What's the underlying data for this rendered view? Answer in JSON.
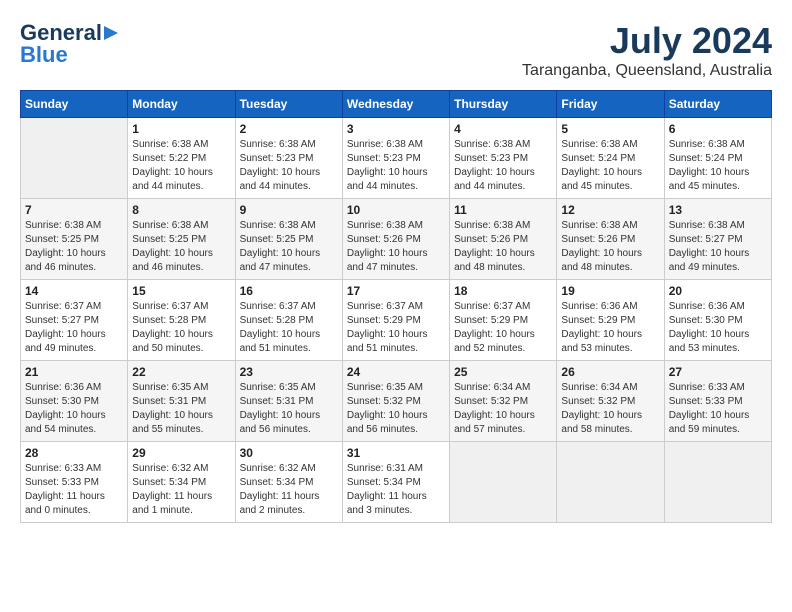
{
  "header": {
    "logo_line1": "General",
    "logo_line2": "Blue",
    "month": "July 2024",
    "location": "Taranganba, Queensland, Australia"
  },
  "weekdays": [
    "Sunday",
    "Monday",
    "Tuesday",
    "Wednesday",
    "Thursday",
    "Friday",
    "Saturday"
  ],
  "weeks": [
    [
      {
        "day": "",
        "info": ""
      },
      {
        "day": "1",
        "info": "Sunrise: 6:38 AM\nSunset: 5:22 PM\nDaylight: 10 hours\nand 44 minutes."
      },
      {
        "day": "2",
        "info": "Sunrise: 6:38 AM\nSunset: 5:23 PM\nDaylight: 10 hours\nand 44 minutes."
      },
      {
        "day": "3",
        "info": "Sunrise: 6:38 AM\nSunset: 5:23 PM\nDaylight: 10 hours\nand 44 minutes."
      },
      {
        "day": "4",
        "info": "Sunrise: 6:38 AM\nSunset: 5:23 PM\nDaylight: 10 hours\nand 44 minutes."
      },
      {
        "day": "5",
        "info": "Sunrise: 6:38 AM\nSunset: 5:24 PM\nDaylight: 10 hours\nand 45 minutes."
      },
      {
        "day": "6",
        "info": "Sunrise: 6:38 AM\nSunset: 5:24 PM\nDaylight: 10 hours\nand 45 minutes."
      }
    ],
    [
      {
        "day": "7",
        "info": "Sunrise: 6:38 AM\nSunset: 5:25 PM\nDaylight: 10 hours\nand 46 minutes."
      },
      {
        "day": "8",
        "info": "Sunrise: 6:38 AM\nSunset: 5:25 PM\nDaylight: 10 hours\nand 46 minutes."
      },
      {
        "day": "9",
        "info": "Sunrise: 6:38 AM\nSunset: 5:25 PM\nDaylight: 10 hours\nand 47 minutes."
      },
      {
        "day": "10",
        "info": "Sunrise: 6:38 AM\nSunset: 5:26 PM\nDaylight: 10 hours\nand 47 minutes."
      },
      {
        "day": "11",
        "info": "Sunrise: 6:38 AM\nSunset: 5:26 PM\nDaylight: 10 hours\nand 48 minutes."
      },
      {
        "day": "12",
        "info": "Sunrise: 6:38 AM\nSunset: 5:26 PM\nDaylight: 10 hours\nand 48 minutes."
      },
      {
        "day": "13",
        "info": "Sunrise: 6:38 AM\nSunset: 5:27 PM\nDaylight: 10 hours\nand 49 minutes."
      }
    ],
    [
      {
        "day": "14",
        "info": "Sunrise: 6:37 AM\nSunset: 5:27 PM\nDaylight: 10 hours\nand 49 minutes."
      },
      {
        "day": "15",
        "info": "Sunrise: 6:37 AM\nSunset: 5:28 PM\nDaylight: 10 hours\nand 50 minutes."
      },
      {
        "day": "16",
        "info": "Sunrise: 6:37 AM\nSunset: 5:28 PM\nDaylight: 10 hours\nand 51 minutes."
      },
      {
        "day": "17",
        "info": "Sunrise: 6:37 AM\nSunset: 5:29 PM\nDaylight: 10 hours\nand 51 minutes."
      },
      {
        "day": "18",
        "info": "Sunrise: 6:37 AM\nSunset: 5:29 PM\nDaylight: 10 hours\nand 52 minutes."
      },
      {
        "day": "19",
        "info": "Sunrise: 6:36 AM\nSunset: 5:29 PM\nDaylight: 10 hours\nand 53 minutes."
      },
      {
        "day": "20",
        "info": "Sunrise: 6:36 AM\nSunset: 5:30 PM\nDaylight: 10 hours\nand 53 minutes."
      }
    ],
    [
      {
        "day": "21",
        "info": "Sunrise: 6:36 AM\nSunset: 5:30 PM\nDaylight: 10 hours\nand 54 minutes."
      },
      {
        "day": "22",
        "info": "Sunrise: 6:35 AM\nSunset: 5:31 PM\nDaylight: 10 hours\nand 55 minutes."
      },
      {
        "day": "23",
        "info": "Sunrise: 6:35 AM\nSunset: 5:31 PM\nDaylight: 10 hours\nand 56 minutes."
      },
      {
        "day": "24",
        "info": "Sunrise: 6:35 AM\nSunset: 5:32 PM\nDaylight: 10 hours\nand 56 minutes."
      },
      {
        "day": "25",
        "info": "Sunrise: 6:34 AM\nSunset: 5:32 PM\nDaylight: 10 hours\nand 57 minutes."
      },
      {
        "day": "26",
        "info": "Sunrise: 6:34 AM\nSunset: 5:32 PM\nDaylight: 10 hours\nand 58 minutes."
      },
      {
        "day": "27",
        "info": "Sunrise: 6:33 AM\nSunset: 5:33 PM\nDaylight: 10 hours\nand 59 minutes."
      }
    ],
    [
      {
        "day": "28",
        "info": "Sunrise: 6:33 AM\nSunset: 5:33 PM\nDaylight: 11 hours\nand 0 minutes."
      },
      {
        "day": "29",
        "info": "Sunrise: 6:32 AM\nSunset: 5:34 PM\nDaylight: 11 hours\nand 1 minute."
      },
      {
        "day": "30",
        "info": "Sunrise: 6:32 AM\nSunset: 5:34 PM\nDaylight: 11 hours\nand 2 minutes."
      },
      {
        "day": "31",
        "info": "Sunrise: 6:31 AM\nSunset: 5:34 PM\nDaylight: 11 hours\nand 3 minutes."
      },
      {
        "day": "",
        "info": ""
      },
      {
        "day": "",
        "info": ""
      },
      {
        "day": "",
        "info": ""
      }
    ]
  ]
}
